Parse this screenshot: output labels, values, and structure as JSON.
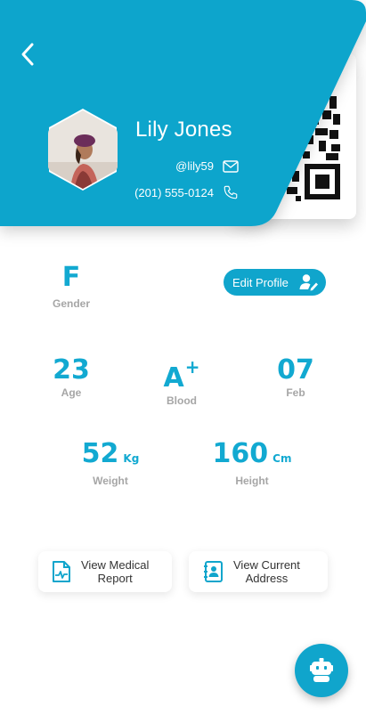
{
  "profile": {
    "name": "Lily Jones",
    "username": "@lily59",
    "phone": "(201) 555-0124"
  },
  "stats": {
    "gender": {
      "value": "F",
      "label": "Gender"
    },
    "age": {
      "value": "23",
      "label": "Age"
    },
    "blood": {
      "value": "A",
      "sign": "+",
      "label": "Blood"
    },
    "birth_day": {
      "value": "07",
      "label": "Feb"
    },
    "weight": {
      "value": "52",
      "unit": "Kg",
      "label": "Weight"
    },
    "height": {
      "value": "160",
      "unit": "Cm",
      "label": "Height"
    }
  },
  "actions": {
    "edit_profile": "Edit Profile",
    "medical_report_line1": "View Medical",
    "medical_report_line2": "Report",
    "address_line1": "View Current",
    "address_line2": "Address"
  },
  "icons": {
    "back": "chevron-left-icon",
    "email": "mail-icon",
    "phone": "phone-icon",
    "edit": "user-edit-icon",
    "report": "medical-report-icon",
    "address": "address-book-icon",
    "assistant": "robot-icon",
    "qr": "qr-code"
  },
  "colors": {
    "primary": "#10a5cc",
    "stat_value": "#12a9d1",
    "stat_label": "#a6a6a6"
  }
}
